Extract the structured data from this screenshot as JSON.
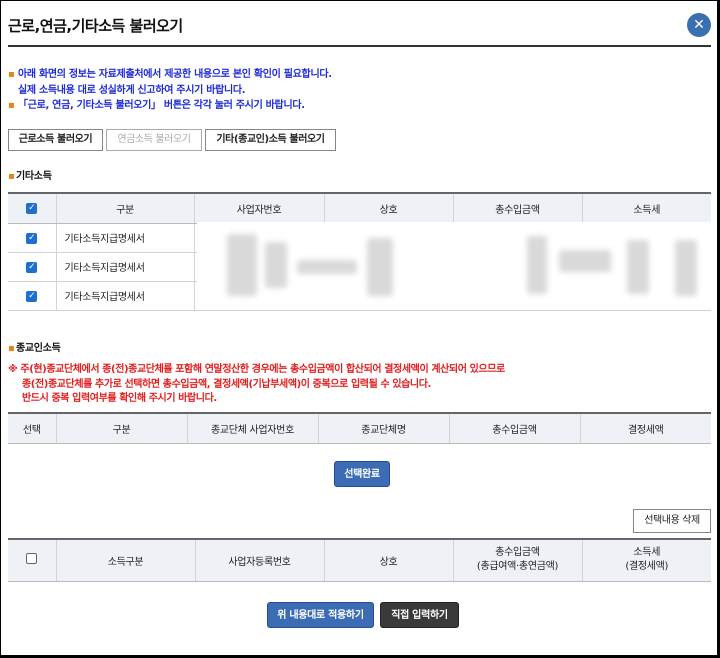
{
  "dialog": {
    "title": "근로,연금,기타소득 불러오기",
    "close_label": "✕"
  },
  "notice": [
    "아래 화면의 정보는 자료제출처에서 제공한 내용으로 본인 확인이 필요합니다.",
    "실제 소득내용 대로 성실하게 신고하여 주시기 바랍니다.",
    "「근로, 연금, 기타소득 불러오기」 버튼은 각각 눌러 주시기 바랍니다."
  ],
  "load_buttons": {
    "earned": "근로소득 불러오기",
    "pension": "연금소득 불러오기",
    "other": "기타(종교인)소득 불러오기"
  },
  "other_income": {
    "section_title": "기타소득",
    "headers": [
      "구분",
      "사업자번호",
      "상호",
      "총수입금액",
      "소득세"
    ],
    "rows": [
      {
        "checked": true,
        "category": "기타소득지급명세서"
      },
      {
        "checked": true,
        "category": "기타소득지급명세서"
      },
      {
        "checked": true,
        "category": "기타소득지급명세서"
      }
    ]
  },
  "religious_income": {
    "section_title": "종교인소득",
    "warning": [
      "※ 주(현)종교단체에서 종(전)종교단체를 포함해 연말정산한 경우에는 총수입금액이 합산되어 결정세액이 계산되어 있으므로",
      "종(전)종교단체를 추가로 선택하면 총수입금액, 결정세액(기납부세액)이 중복으로 입력될 수 있습니다.",
      "반드시 중복 입력여부를 확인해 주시기 바랍니다."
    ],
    "headers": [
      "선택",
      "구분",
      "종교단체 사업자번호",
      "종교단체명",
      "총수입금액",
      "결정세액"
    ],
    "select_done_label": "선택완료"
  },
  "selected": {
    "delete_label": "선택내용 삭제",
    "headers": [
      "소득구분",
      "사업자등록번호",
      "상호"
    ],
    "header_revenue": [
      "총수입금액",
      "(총급여액·총연금액)"
    ],
    "header_tax": [
      "소득세",
      "(결정세액)"
    ]
  },
  "footer": {
    "apply_label": "위 내용대로 적용하기",
    "manual_label": "직접 입력하기"
  },
  "colors": {
    "accent": "#3c6db4",
    "warning": "#e02020",
    "notice": "#1f2bd6",
    "bullet": "#e0861a"
  }
}
